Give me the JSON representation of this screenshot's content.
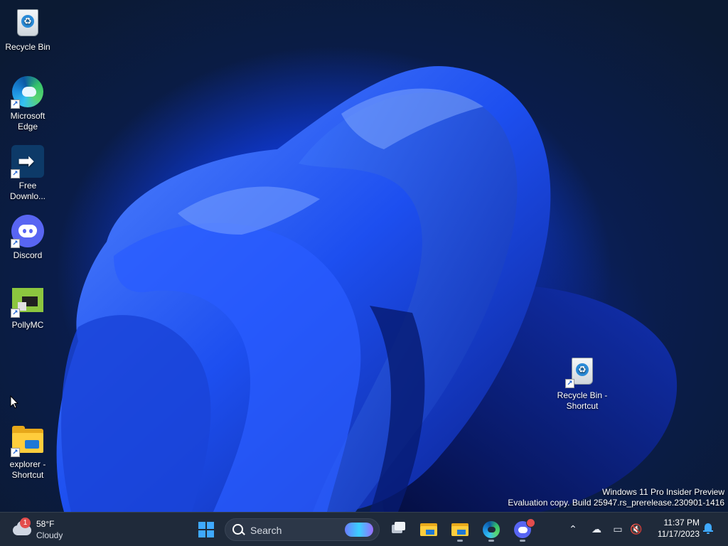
{
  "desktop_icons": [
    {
      "label": "Recycle Bin",
      "icon": "recycle-bin-icon"
    },
    {
      "label": "Microsoft Edge",
      "icon": "edge-icon",
      "shortcut": true
    },
    {
      "label": "Free Downlo...",
      "icon": "free-download-manager-icon",
      "shortcut": true
    },
    {
      "label": "Discord",
      "icon": "discord-icon",
      "shortcut": true
    },
    {
      "label": "PollyMC",
      "icon": "pollymc-icon",
      "shortcut": true
    },
    {
      "label": "explorer - Shortcut",
      "icon": "folder-icon",
      "shortcut": true
    },
    {
      "label": "Recycle Bin - Shortcut",
      "icon": "recycle-bin-icon",
      "shortcut": true
    }
  ],
  "watermark": {
    "line1": "Windows 11 Pro Insider Preview",
    "line2": "Evaluation copy. Build 25947.rs_prerelease.230901-1416"
  },
  "taskbar": {
    "weather": {
      "temp": "58°F",
      "condition": "Cloudy",
      "badge": "1"
    },
    "search": {
      "label": "Search"
    },
    "pinned": [
      "start-icon",
      "task-view-icon",
      "file-explorer-icon",
      "file-explorer-icon",
      "edge-icon",
      "discord-icon"
    ],
    "clock": {
      "time": "11:37 PM",
      "date": "11/17/2023"
    }
  },
  "colors": {
    "accent": "#3fa9ff",
    "taskbar_bg": "#1f2a3a",
    "wallpaper_blue": "#1c4fe0"
  }
}
